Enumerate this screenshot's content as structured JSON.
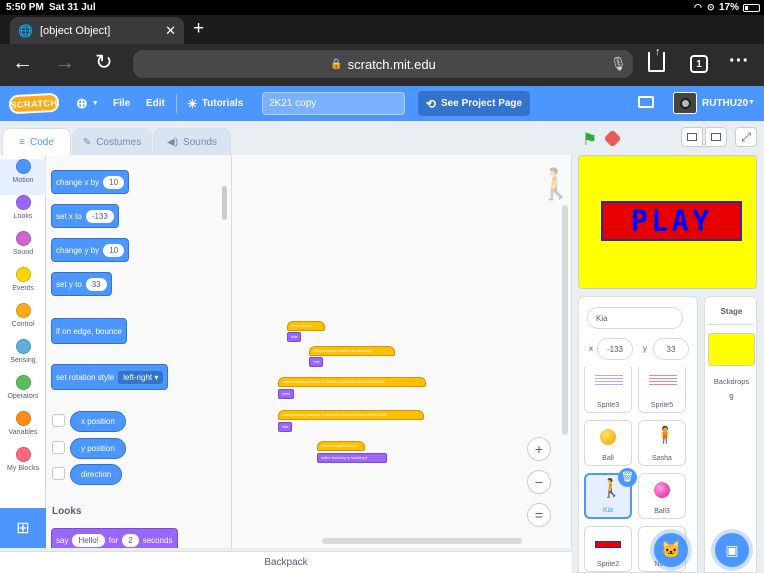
{
  "status": {
    "time": "5:50 PM",
    "date": "Sat 31 Jul",
    "battery": "17%"
  },
  "browser": {
    "tab_title": "[object Object]",
    "url": "scratch.mit.edu",
    "tab_count": "1"
  },
  "menu": {
    "file": "File",
    "edit": "Edit",
    "tutorials": "Tutorials",
    "project_title": "2K21 copy",
    "see_project": "See Project Page",
    "username": "RUTHU20",
    "logo": "SCRATCH"
  },
  "tabs": {
    "code": "Code",
    "costumes": "Costumes",
    "sounds": "Sounds"
  },
  "categories": [
    {
      "label": "Motion",
      "color": "#4c97ff"
    },
    {
      "label": "Looks",
      "color": "#9966ff"
    },
    {
      "label": "Sound",
      "color": "#cf63cf"
    },
    {
      "label": "Events",
      "color": "#ffd500"
    },
    {
      "label": "Control",
      "color": "#ffab19"
    },
    {
      "label": "Sensing",
      "color": "#5cb1d6"
    },
    {
      "label": "Operators",
      "color": "#59c059"
    },
    {
      "label": "Variables",
      "color": "#ff8c1a"
    },
    {
      "label": "My Blocks",
      "color": "#ff6680"
    }
  ],
  "palette": {
    "change_x": {
      "label": "change x by",
      "value": "10"
    },
    "set_x": {
      "label": "set x to",
      "value": "-133"
    },
    "change_y": {
      "label": "change y by",
      "value": "10"
    },
    "set_y": {
      "label": "set y to",
      "value": "33"
    },
    "bounce": "if on edge, bounce",
    "rotation": {
      "label": "set rotation style",
      "value": "left-right"
    },
    "reporters": [
      "x position",
      "y position",
      "direction"
    ],
    "looks_heading": "Looks",
    "say": {
      "label": "say",
      "message": "Hello!",
      "for": "for",
      "seconds": "2",
      "unit": "seconds"
    }
  },
  "code_scripts": [
    {
      "event": "when clicked",
      "action": "hide"
    },
    {
      "event": "when backdrop switches to",
      "value": "backdrop4",
      "action": "hide"
    },
    {
      "event": "when backdrop switches to",
      "value": "2f45601-01c0-468f-ad09-e7a3c34f07f1",
      "action": "show"
    },
    {
      "event": "when backdrop switches to",
      "value": "9a0f9f45-6da6-4b1d-b1e5-cf8e3f1c9df0",
      "action": "hide"
    },
    {
      "event": "when this sprite clicked",
      "action": "switch backdrop to",
      "value": "backdrop4"
    }
  ],
  "stage": {
    "play_text": "PLAY",
    "bg_color": "#ffff00"
  },
  "sprite_info": {
    "name": "Kia",
    "x_label": "x",
    "x": "-133",
    "y_label": "y",
    "y": "33"
  },
  "sprites": [
    "Sprite3",
    "Sprite5",
    "Ball",
    "Sasha",
    "Kia",
    "Ball3",
    "Sprite2",
    "Noor"
  ],
  "stage_panel": {
    "title": "Stage",
    "backdrops_label": "Backdrops",
    "backdrops_count": "9"
  },
  "backpack": "Backpack"
}
